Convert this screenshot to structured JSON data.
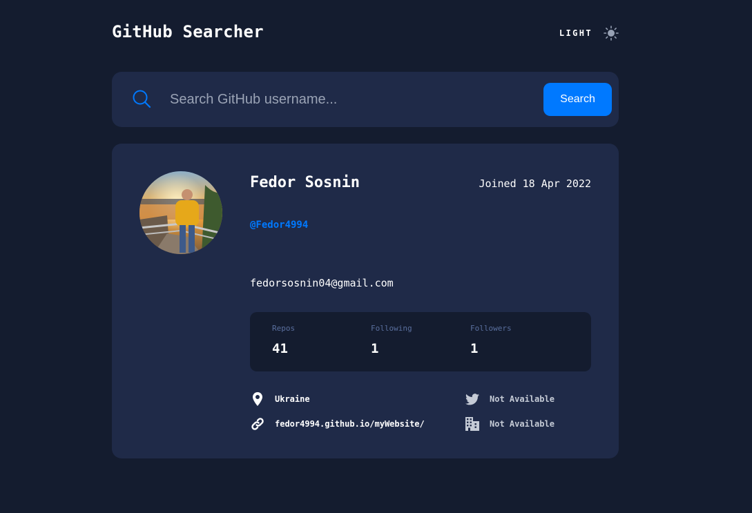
{
  "header": {
    "title": "GitHub Searcher",
    "theme_toggle_label": "LIGHT",
    "theme_icon": "sun-icon"
  },
  "search": {
    "placeholder": "Search GitHub username...",
    "value": "",
    "button_label": "Search",
    "icon": "search-icon"
  },
  "profile": {
    "name": "Fedor Sosnin",
    "joined": "Joined 18 Apr 2022",
    "login": "@Fedor4994",
    "email": "fedorsosnin04@gmail.com",
    "stats": [
      {
        "label": "Repos",
        "value": "41"
      },
      {
        "label": "Following",
        "value": "1"
      },
      {
        "label": "Followers",
        "value": "1"
      }
    ],
    "links": {
      "location": {
        "icon": "location-pin-icon",
        "text": "Ukraine"
      },
      "blog": {
        "icon": "link-icon",
        "text": "fedor4994.github.io/myWebsite/"
      },
      "twitter": {
        "icon": "twitter-icon",
        "text": "Not Available"
      },
      "company": {
        "icon": "company-building-icon",
        "text": "Not Available"
      }
    }
  },
  "colors": {
    "background": "#141c2f",
    "card": "#1f2a48",
    "accent": "#0079ff",
    "stat_label": "#5a6f9e"
  }
}
